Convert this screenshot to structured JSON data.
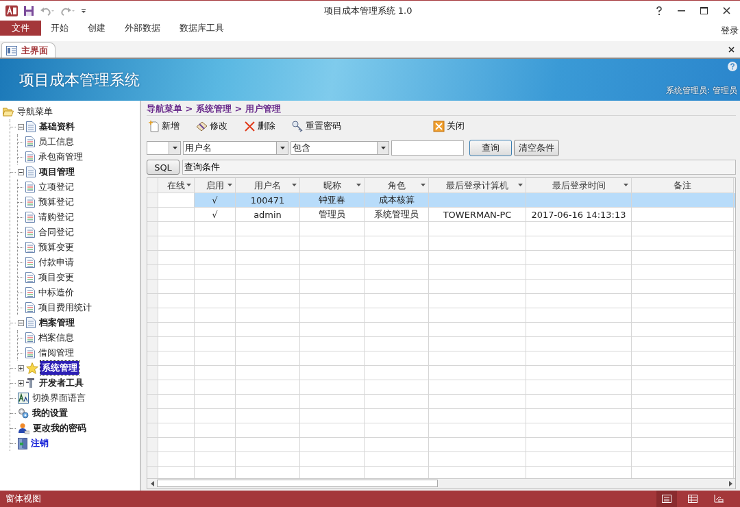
{
  "window": {
    "title": "项目成本管理系统 1.0"
  },
  "ribbon_tabs": [
    {
      "label": "文件",
      "selected": true
    },
    {
      "label": "开始",
      "selected": false
    },
    {
      "label": "创建",
      "selected": false
    },
    {
      "label": "外部数据",
      "selected": false
    },
    {
      "label": "数据库工具",
      "selected": false
    }
  ],
  "sign_in": "登录",
  "document_tabs": [
    {
      "label": "主界面",
      "selected": true
    }
  ],
  "banner": {
    "title": "项目成本管理系统",
    "user": "系统管理员: 管理员"
  },
  "nav_tree": [
    {
      "label": "导航菜单",
      "kind": "folder",
      "bold": false,
      "selected": false,
      "children": [
        {
          "label": "基础资料",
          "kind": "section",
          "bold": true,
          "selected": false,
          "expanded": true,
          "children": [
            {
              "label": "员工信息",
              "kind": "page",
              "bold": false,
              "selected": false
            },
            {
              "label": "承包商管理",
              "kind": "page",
              "bold": false,
              "selected": false
            }
          ]
        },
        {
          "label": "项目管理",
          "kind": "section",
          "bold": true,
          "selected": false,
          "expanded": true,
          "children": [
            {
              "label": "立项登记",
              "kind": "page",
              "bold": false,
              "selected": false
            },
            {
              "label": "预算登记",
              "kind": "page",
              "bold": false,
              "selected": false
            },
            {
              "label": "请购登记",
              "kind": "page",
              "bold": false,
              "selected": false
            },
            {
              "label": "合同登记",
              "kind": "page",
              "bold": false,
              "selected": false
            },
            {
              "label": "预算变更",
              "kind": "page",
              "bold": false,
              "selected": false
            },
            {
              "label": "付款申请",
              "kind": "page",
              "bold": false,
              "selected": false
            },
            {
              "label": "项目变更",
              "kind": "page",
              "bold": false,
              "selected": false
            },
            {
              "label": "中标造价",
              "kind": "page",
              "bold": false,
              "selected": false
            },
            {
              "label": "项目费用统计",
              "kind": "page",
              "bold": false,
              "selected": false
            }
          ]
        },
        {
          "label": "档案管理",
          "kind": "section",
          "bold": true,
          "selected": false,
          "expanded": true,
          "children": [
            {
              "label": "档案信息",
              "kind": "page",
              "bold": false,
              "selected": false
            },
            {
              "label": "借阅管理",
              "kind": "page",
              "bold": false,
              "selected": false
            }
          ]
        },
        {
          "label": "系统管理",
          "kind": "star",
          "bold": true,
          "selected": true,
          "expanded": false
        },
        {
          "label": "开发者工具",
          "kind": "tools",
          "bold": true,
          "selected": false,
          "expanded": false
        },
        {
          "label": "切换界面语言",
          "kind": "language",
          "bold": false,
          "selected": false
        },
        {
          "label": "我的设置",
          "kind": "settings",
          "bold": true,
          "selected": false
        },
        {
          "label": "更改我的密码",
          "kind": "user",
          "bold": true,
          "selected": false
        },
        {
          "label": "注销",
          "kind": "logout",
          "bold": true,
          "selected": false
        }
      ]
    }
  ],
  "breadcrumb": "导航菜单 > 系统管理 > 用户管理",
  "toolbar": [
    {
      "label": "新增",
      "kind": "new"
    },
    {
      "label": "修改",
      "kind": "edit"
    },
    {
      "label": "删除",
      "kind": "delete"
    },
    {
      "label": "重置密码",
      "kind": "key"
    },
    {
      "label": "关闭",
      "kind": "close"
    }
  ],
  "filter": {
    "field": "用户名",
    "operator": "包含",
    "search_button": "查询",
    "clear_button": "清空条件",
    "sql_button": "SQL",
    "condition": "查询条件"
  },
  "table": {
    "columns": [
      {
        "label": "在线",
        "filter": true
      },
      {
        "label": "启用",
        "filter": true
      },
      {
        "label": "用户名",
        "filter": true
      },
      {
        "label": "昵称",
        "filter": true
      },
      {
        "label": "角色",
        "filter": true
      },
      {
        "label": "最后登录计算机",
        "filter": true
      },
      {
        "label": "最后登录时间",
        "filter": true
      },
      {
        "label": "备注",
        "filter": false
      }
    ],
    "rows": [
      {
        "selected": true,
        "cells": [
          null,
          "√",
          "100471",
          "钟亚春",
          "成本核算",
          null,
          null,
          null
        ]
      },
      {
        "selected": false,
        "cells": [
          null,
          "√",
          "admin",
          "管理员",
          "系统管理员",
          "TOWERMAN-PC",
          "2017-06-16 14:13:13",
          null
        ]
      }
    ]
  },
  "status_bar": {
    "text": "窗体视图",
    "views": [
      {
        "kind": "form",
        "selected": true
      },
      {
        "kind": "datasheet",
        "selected": false
      },
      {
        "kind": "layout",
        "selected": false
      }
    ]
  }
}
